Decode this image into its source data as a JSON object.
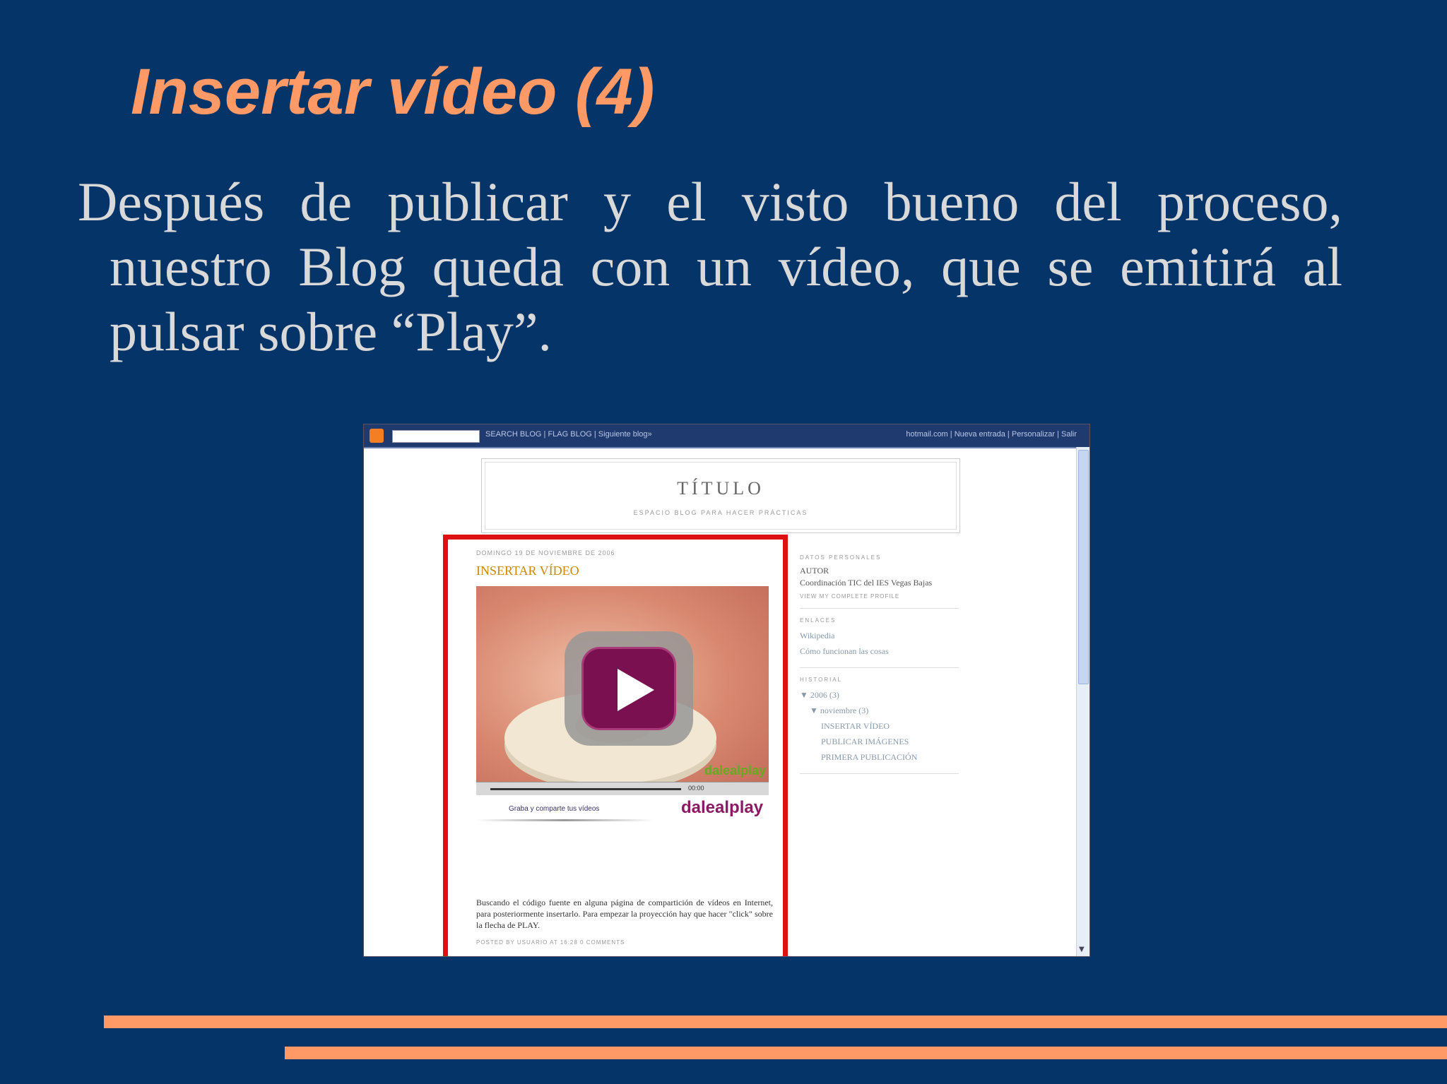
{
  "slide": {
    "title": "Insertar vídeo (4)",
    "body": "Después de publicar y el visto bueno del proceso, nuestro Blog queda con un vídeo, que se emitirá al pulsar sobre “Play”.",
    "accent_color": "#ff9966",
    "background_color": "#043468"
  },
  "screenshot": {
    "navbar": {
      "search_button": "SEARCH BLOG",
      "flag_button": "FLAG BLOG",
      "next_blog": "Siguiente blog»",
      "account": "hotmail.com",
      "new_post": "Nueva entrada",
      "customize": "Personalizar",
      "logout": "Salir"
    },
    "header": {
      "title": "TÍTULO",
      "description": "ESPACIO BLOG PARA HACER PRÁCTICAS"
    },
    "post": {
      "date": "DOMINGO 19 DE NOVIEMBRE DE 2006",
      "title": "INSERTAR VÍDEO",
      "video_brand": "dalealplay",
      "video_time": "00:00",
      "share_link": "Graba y comparte tus vídeos",
      "logo": "dalealplay",
      "body": "Buscando el código fuente en alguna página de compartición de vídeos en Internet, para posteriormente insertarlo. Para empezar la proyección hay que hacer \"click\" sobre la flecha de PLAY.",
      "footer": "POSTED BY USUARIO AT 16:28   0 COMMENTS"
    },
    "sidebar": {
      "about_heading": "DATOS PERSONALES",
      "author": "AUTOR",
      "author_desc": "Coordinación TIC del IES Vegas Bajas",
      "profile_link": "VIEW MY COMPLETE PROFILE",
      "links_heading": "ENLACES",
      "links": [
        "Wikipedia",
        "Cómo funcionan las cosas"
      ],
      "archive_heading": "HISTORIAL",
      "archive_year": "▼ 2006 (3)",
      "archive_month": "▼ noviembre (3)",
      "archive_posts": [
        "INSERTAR VÍDEO",
        "PUBLICAR IMÁGENES",
        "PRIMERA PUBLICACIÓN"
      ]
    }
  }
}
